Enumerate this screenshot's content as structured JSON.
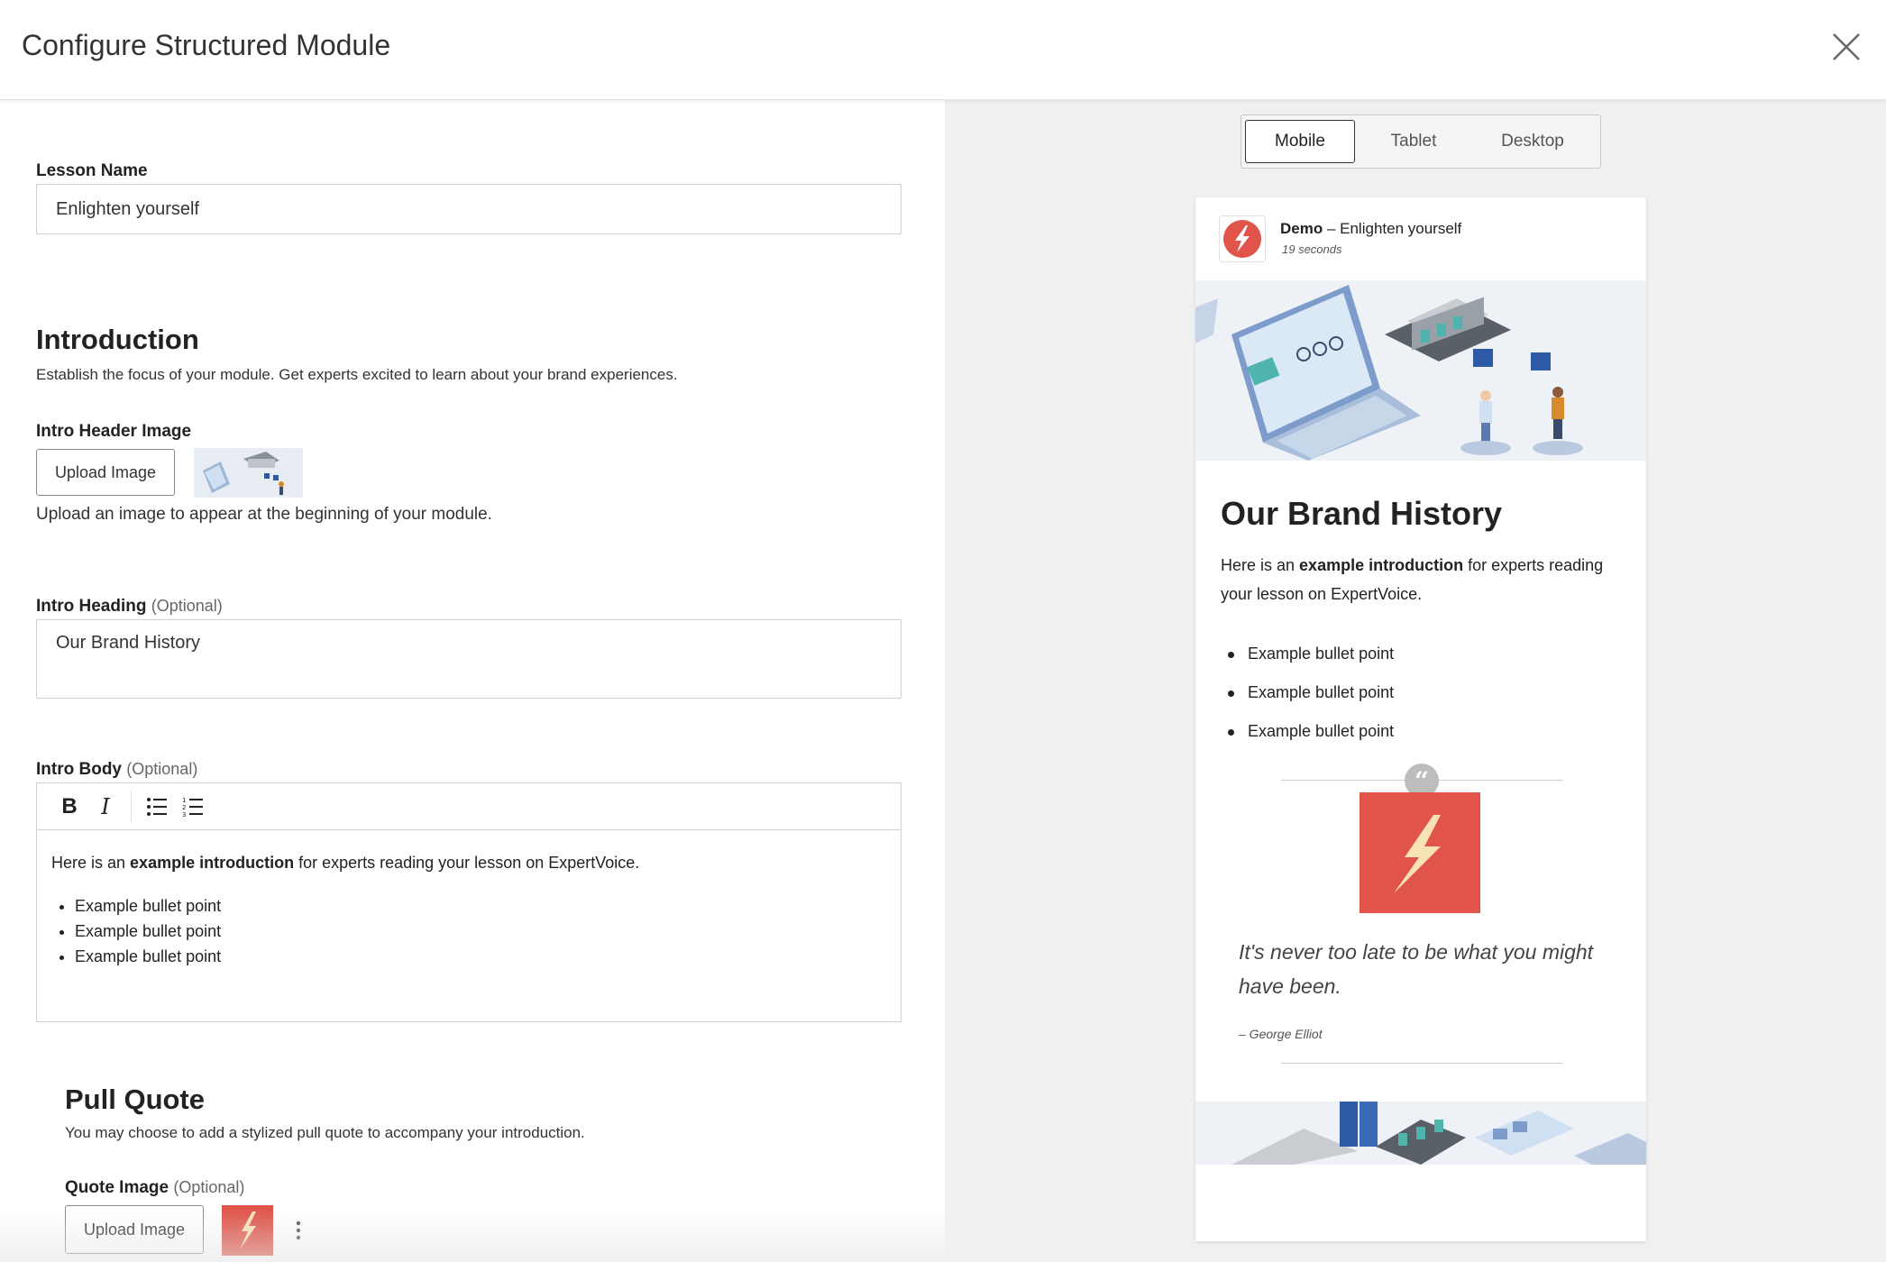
{
  "header": {
    "title": "Configure Structured Module"
  },
  "form": {
    "lesson_name_label": "Lesson Name",
    "lesson_name_value": "Enlighten yourself",
    "intro": {
      "title": "Introduction",
      "description": "Establish the focus of your module. Get experts excited to learn about your brand experiences.",
      "header_image_label": "Intro Header Image",
      "upload_label": "Upload Image",
      "upload_helper": "Upload an image to appear at the beginning of your module.",
      "heading_label": "Intro Heading",
      "optional": "(Optional)",
      "heading_value": "Our Brand History",
      "body_label": "Intro Body",
      "body_text_pre": "Here is an ",
      "body_text_bold": "example introduction",
      "body_text_post": " for experts reading your lesson on ExpertVoice.",
      "bullets": [
        "Example bullet point",
        "Example bullet point",
        "Example bullet point"
      ]
    },
    "toolbar": {
      "bold": "B",
      "italic": "I"
    },
    "pull_quote": {
      "title": "Pull Quote",
      "description": "You may choose to add a stylized pull quote to accompany your introduction.",
      "image_label": "Quote Image",
      "optional": "(Optional)",
      "upload_label": "Upload Image"
    }
  },
  "preview": {
    "tabs": [
      "Mobile",
      "Tablet",
      "Desktop"
    ],
    "active_tab": "Mobile",
    "brand": "Demo",
    "separator": " – ",
    "lesson_title": "Enlighten yourself",
    "duration": "19 seconds",
    "heading": "Our Brand History",
    "body_pre": "Here is an ",
    "body_bold": "example introduction",
    "body_post": " for experts reading your lesson on ExpertVoice.",
    "bullets": [
      "Example bullet point",
      "Example bullet point",
      "Example bullet point"
    ],
    "quote_mark": "“",
    "quote": "It's never too late to be what you might have been.",
    "quote_author": "– George Elliot"
  },
  "colors": {
    "brand_red": "#e0544a",
    "bolt": "#f7e3b5"
  }
}
